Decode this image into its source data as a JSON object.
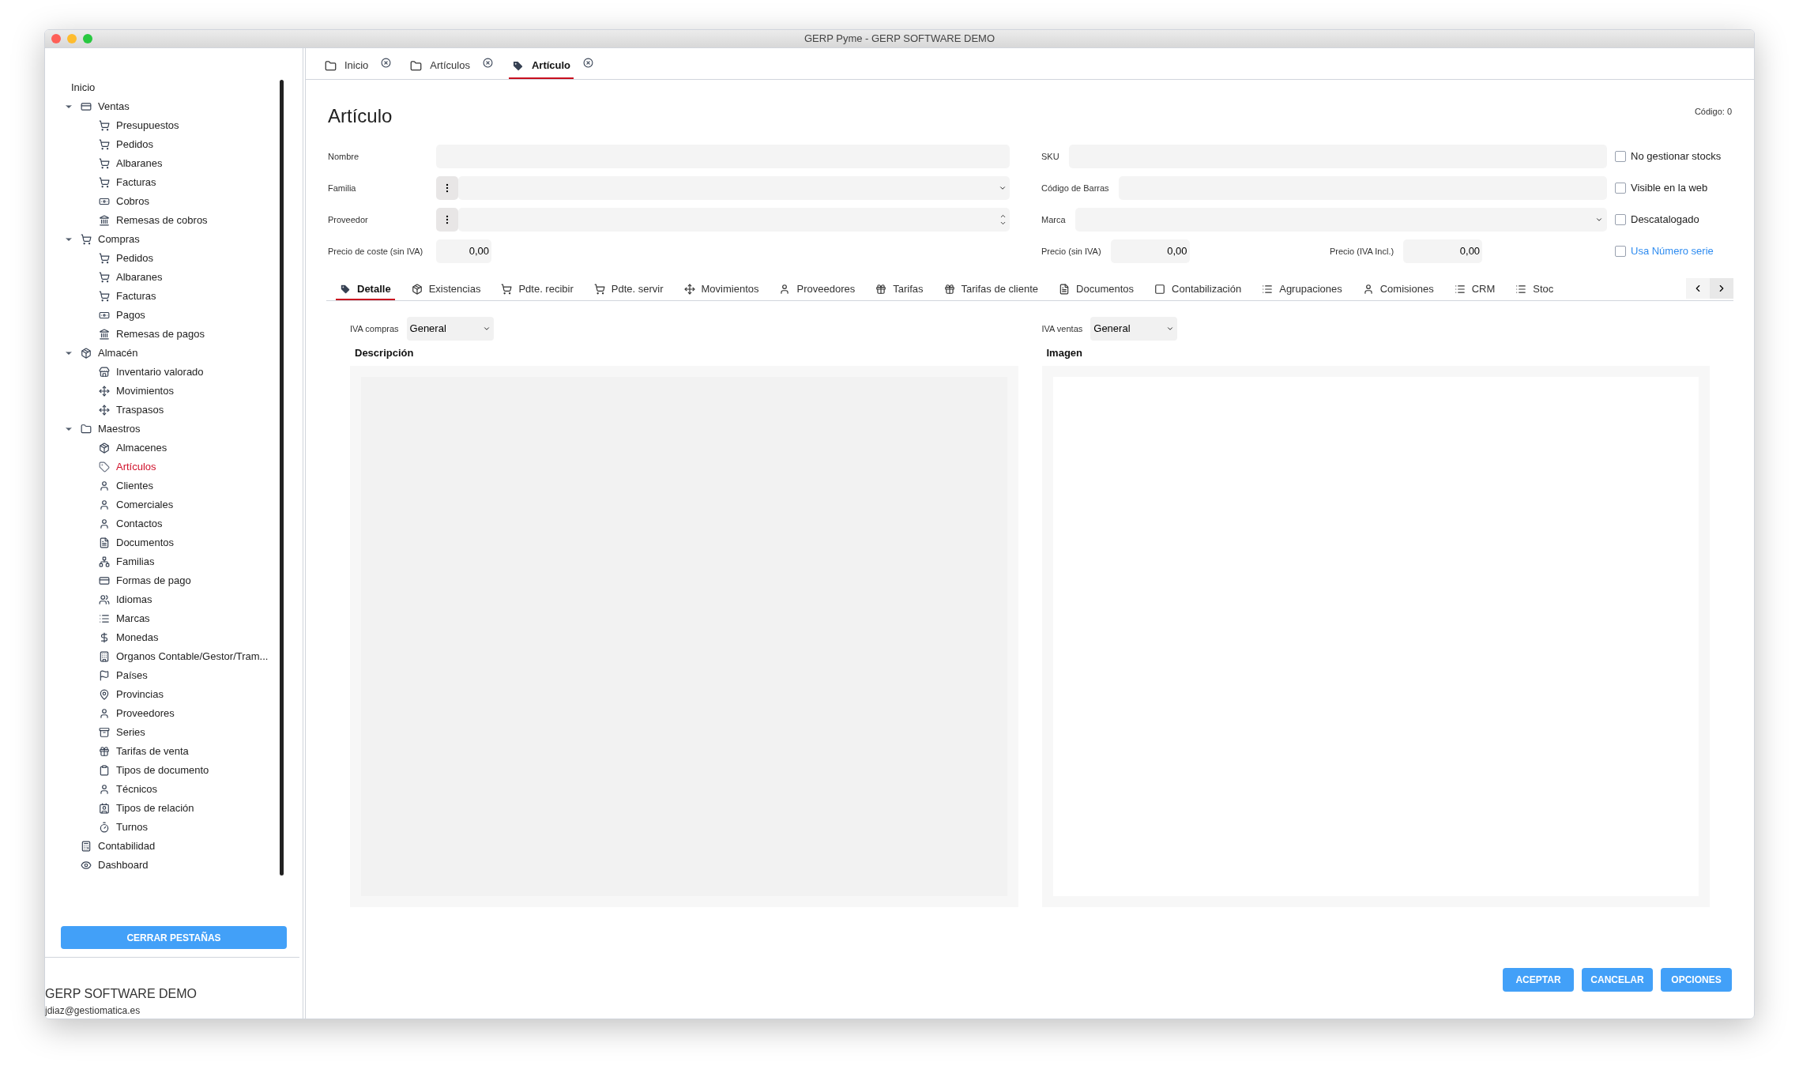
{
  "window": {
    "title": "GERP Pyme - GERP SOFTWARE DEMO"
  },
  "sidebar": {
    "items": [
      {
        "label": "Inicio",
        "selected": false
      },
      {
        "label": "Ventas",
        "selected": false,
        "expanded": true,
        "children": [
          {
            "label": "Presupuestos",
            "selected": false
          },
          {
            "label": "Pedidos",
            "selected": false
          },
          {
            "label": "Albaranes",
            "selected": false
          },
          {
            "label": "Facturas",
            "selected": false
          },
          {
            "label": "Cobros",
            "selected": false
          },
          {
            "label": "Remesas de cobros",
            "selected": false
          }
        ]
      },
      {
        "label": "Compras",
        "selected": false,
        "expanded": true,
        "children": [
          {
            "label": "Pedidos",
            "selected": false
          },
          {
            "label": "Albaranes",
            "selected": false
          },
          {
            "label": "Facturas",
            "selected": false
          },
          {
            "label": "Pagos",
            "selected": false
          },
          {
            "label": "Remesas de pagos",
            "selected": false
          }
        ]
      },
      {
        "label": "Almacén",
        "selected": false,
        "expanded": true,
        "children": [
          {
            "label": "Inventario valorado",
            "selected": false
          },
          {
            "label": "Movimientos",
            "selected": false
          },
          {
            "label": "Traspasos",
            "selected": false
          }
        ]
      },
      {
        "label": "Maestros",
        "selected": false,
        "expanded": true,
        "children": [
          {
            "label": "Almacenes",
            "selected": false
          },
          {
            "label": "Artículos",
            "selected": true
          },
          {
            "label": "Clientes",
            "selected": false
          },
          {
            "label": "Comerciales",
            "selected": false
          },
          {
            "label": "Contactos",
            "selected": false
          },
          {
            "label": "Documentos",
            "selected": false
          },
          {
            "label": "Familias",
            "selected": false
          },
          {
            "label": "Formas de pago",
            "selected": false
          },
          {
            "label": "Idiomas",
            "selected": false
          },
          {
            "label": "Marcas",
            "selected": false
          },
          {
            "label": "Monedas",
            "selected": false
          },
          {
            "label": "Organos Contable/Gestor/Tram...",
            "selected": false
          },
          {
            "label": "Países",
            "selected": false
          },
          {
            "label": "Provincias",
            "selected": false
          },
          {
            "label": "Proveedores",
            "selected": false
          },
          {
            "label": "Series",
            "selected": false
          },
          {
            "label": "Tarifas de venta",
            "selected": false
          },
          {
            "label": "Tipos de documento",
            "selected": false
          },
          {
            "label": "Técnicos",
            "selected": false
          },
          {
            "label": "Tipos de relación",
            "selected": false
          },
          {
            "label": "Turnos",
            "selected": false
          }
        ]
      },
      {
        "label": "Contabilidad",
        "selected": false
      },
      {
        "label": "Dashboard",
        "selected": false
      }
    ],
    "close_button": "CERRAR PESTAÑAS",
    "company": "GERP SOFTWARE DEMO",
    "email": "jdiaz@gestiomatica.es"
  },
  "tabs": [
    {
      "label": "Inicio",
      "selected": false
    },
    {
      "label": "Artículos",
      "selected": false
    },
    {
      "label": "Artículo",
      "selected": true
    }
  ],
  "form": {
    "title": "Artículo",
    "code": "Código: 0",
    "left_fields": [
      {
        "label": "Nombre",
        "kind": "text"
      },
      {
        "label": "Familia",
        "kind": "select"
      },
      {
        "label": "Proveedor",
        "kind": "combo"
      },
      {
        "label": "Precio de coste (sin IVA)",
        "kind": "number",
        "value": "0,00"
      }
    ],
    "right_fields": [
      {
        "label": "SKU",
        "kind": "text"
      },
      {
        "label": "Código de Barras",
        "kind": "text"
      },
      {
        "label": "Marca",
        "kind": "select"
      }
    ],
    "price_fields": [
      {
        "label": "Precio (sin IVA)",
        "value": "0,00"
      },
      {
        "label": "Precio (IVA Incl.)",
        "value": "0,00"
      }
    ],
    "checkboxes": [
      {
        "label": "No gestionar stocks",
        "checked": false,
        "kind": "plain"
      },
      {
        "label": "Visible en la web",
        "checked": false,
        "kind": "plain"
      },
      {
        "label": "Descatalogado",
        "checked": false,
        "kind": "plain"
      },
      {
        "label": "Usa Número serie",
        "checked": false,
        "kind": "link"
      }
    ]
  },
  "detail_tabs": [
    {
      "label": "Detalle",
      "selected": true
    },
    {
      "label": "Existencias",
      "selected": false
    },
    {
      "label": "Pdte. recibir",
      "selected": false
    },
    {
      "label": "Pdte. servir",
      "selected": false
    },
    {
      "label": "Movimientos",
      "selected": false
    },
    {
      "label": "Proveedores",
      "selected": false
    },
    {
      "label": "Tarifas",
      "selected": false
    },
    {
      "label": "Tarifas de cliente",
      "selected": false
    },
    {
      "label": "Documentos",
      "selected": false
    },
    {
      "label": "Contabilización",
      "selected": false
    },
    {
      "label": "Agrupaciones",
      "selected": false
    },
    {
      "label": "Comisiones",
      "selected": false
    },
    {
      "label": "CRM",
      "selected": false
    },
    {
      "label": "Stoc",
      "selected": false
    }
  ],
  "detail": {
    "iva_compras": {
      "label": "IVA compras",
      "value": "General"
    },
    "iva_ventas": {
      "label": "IVA ventas",
      "value": "General"
    },
    "description_label": "Descripción",
    "image_label": "Imagen"
  },
  "buttons": [
    "ACEPTAR",
    "CANCELAR",
    "OPCIONES"
  ]
}
